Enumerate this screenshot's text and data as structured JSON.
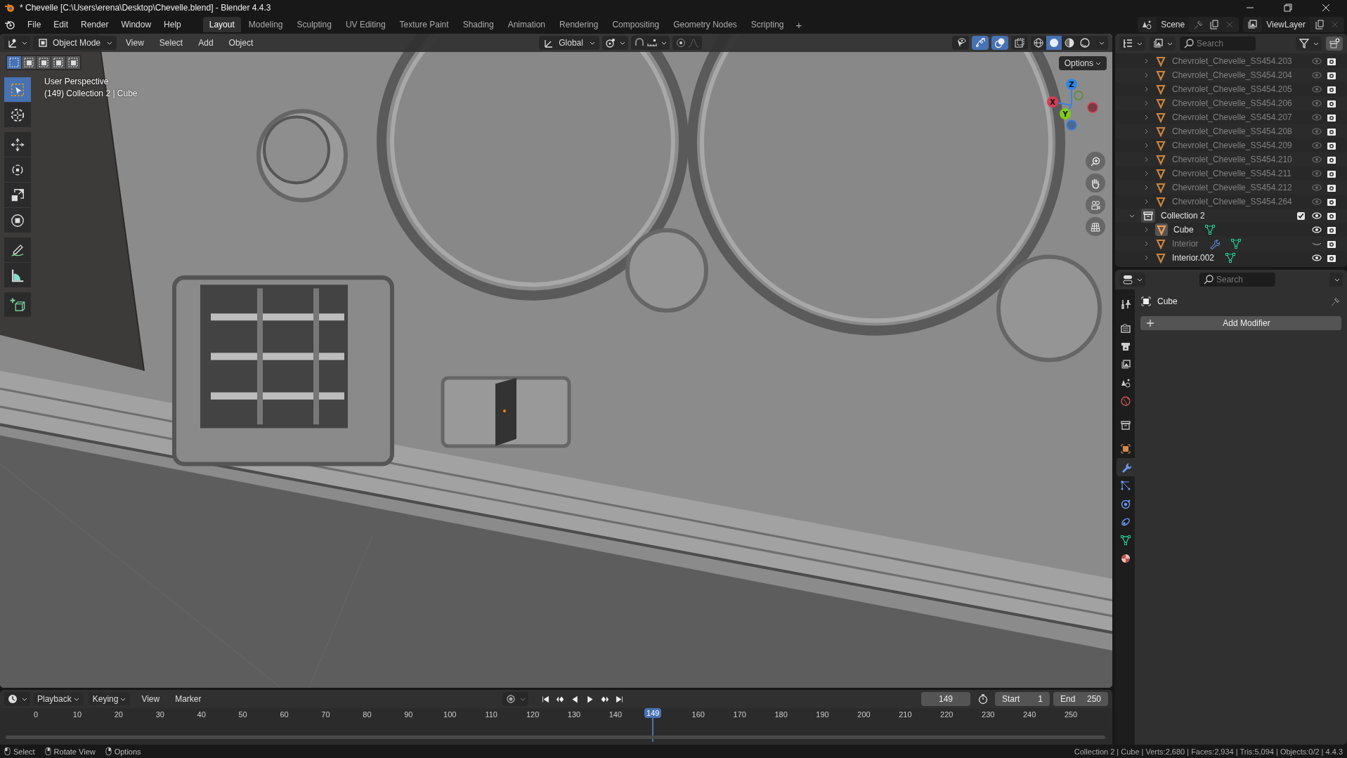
{
  "window": {
    "title": "* Chevelle [C:\\Users\\erena\\Desktop\\Chevelle.blend] - Blender 4.4.3"
  },
  "menu": [
    "File",
    "Edit",
    "Render",
    "Window",
    "Help"
  ],
  "workspace_tabs": [
    {
      "label": "Layout",
      "selected": true
    },
    {
      "label": "Modeling",
      "selected": false
    },
    {
      "label": "Sculpting",
      "selected": false
    },
    {
      "label": "UV Editing",
      "selected": false
    },
    {
      "label": "Texture Paint",
      "selected": false
    },
    {
      "label": "Shading",
      "selected": false
    },
    {
      "label": "Animation",
      "selected": false
    },
    {
      "label": "Rendering",
      "selected": false
    },
    {
      "label": "Compositing",
      "selected": false
    },
    {
      "label": "Geometry Nodes",
      "selected": false
    },
    {
      "label": "Scripting",
      "selected": false
    }
  ],
  "add_workspace": "+",
  "scene": "Scene",
  "view_layer": "ViewLayer",
  "viewport": {
    "mode": "Object Mode",
    "menus": [
      "View",
      "Select",
      "Add",
      "Object"
    ],
    "orientation": "Global",
    "select_modes": [
      {
        "selected": true
      },
      {
        "selected": false
      },
      {
        "selected": false
      },
      {
        "selected": false
      },
      {
        "selected": false
      }
    ],
    "toggles": [
      {
        "selected": false
      },
      {
        "selected": true
      },
      {
        "selected": true
      },
      {
        "selected": false
      }
    ],
    "shading": [
      {
        "selected": false
      },
      {
        "selected": true
      },
      {
        "selected": false
      },
      {
        "selected": false
      }
    ],
    "options": "Options",
    "overlay_text": [
      "User Perspective",
      "(149) Collection 2 | Cube"
    ],
    "tools": [
      {
        "selected": true
      },
      {
        "selected": false
      },
      {
        "selected": false
      },
      {
        "selected": false
      },
      {
        "selected": false
      },
      {
        "selected": false
      },
      {
        "selected": false
      },
      {
        "selected": false
      },
      {
        "selected": false
      }
    ],
    "axes": [
      "X",
      "Y",
      "Z"
    ]
  },
  "outliner": {
    "search_placeholder": "Search",
    "rows": [
      {
        "kind": "object",
        "name": "Chevrolet_Chevelle_SS454.203",
        "expanded": false,
        "dimmed": true,
        "visible": true,
        "active": false,
        "modifier": false,
        "mesh_data": false
      },
      {
        "kind": "object",
        "name": "Chevrolet_Chevelle_SS454.204",
        "expanded": false,
        "dimmed": true,
        "visible": true,
        "active": false,
        "modifier": false,
        "mesh_data": false
      },
      {
        "kind": "object",
        "name": "Chevrolet_Chevelle_SS454.205",
        "expanded": false,
        "dimmed": true,
        "visible": true,
        "active": false,
        "modifier": false,
        "mesh_data": false
      },
      {
        "kind": "object",
        "name": "Chevrolet_Chevelle_SS454.206",
        "expanded": false,
        "dimmed": true,
        "visible": true,
        "active": false,
        "modifier": false,
        "mesh_data": false
      },
      {
        "kind": "object",
        "name": "Chevrolet_Chevelle_SS454.207",
        "expanded": false,
        "dimmed": true,
        "visible": true,
        "active": false,
        "modifier": false,
        "mesh_data": false
      },
      {
        "kind": "object",
        "name": "Chevrolet_Chevelle_SS454.208",
        "expanded": false,
        "dimmed": true,
        "visible": true,
        "active": false,
        "modifier": false,
        "mesh_data": false
      },
      {
        "kind": "object",
        "name": "Chevrolet_Chevelle_SS454.209",
        "expanded": false,
        "dimmed": true,
        "visible": true,
        "active": false,
        "modifier": false,
        "mesh_data": false
      },
      {
        "kind": "object",
        "name": "Chevrolet_Chevelle_SS454.210",
        "expanded": false,
        "dimmed": true,
        "visible": true,
        "active": false,
        "modifier": false,
        "mesh_data": false
      },
      {
        "kind": "object",
        "name": "Chevrolet_Chevelle_SS454.211",
        "expanded": false,
        "dimmed": true,
        "visible": true,
        "active": false,
        "modifier": false,
        "mesh_data": false
      },
      {
        "kind": "object",
        "name": "Chevrolet_Chevelle_SS454.212",
        "expanded": false,
        "dimmed": true,
        "visible": true,
        "active": false,
        "modifier": false,
        "mesh_data": false
      },
      {
        "kind": "object",
        "name": "Chevrolet_Chevelle_SS454.264",
        "expanded": false,
        "dimmed": true,
        "visible": true,
        "active": false,
        "modifier": false,
        "mesh_data": false
      },
      {
        "kind": "collection",
        "name": "Collection 2",
        "expanded": true,
        "checked": true,
        "visible": true,
        "children": [
          {
            "kind": "object",
            "name": "Cube",
            "expanded": false,
            "dimmed": false,
            "visible": true,
            "active": true,
            "modifier": false,
            "mesh_data": true
          },
          {
            "kind": "object",
            "name": "Interior",
            "expanded": false,
            "dimmed": true,
            "visible": false,
            "active": false,
            "modifier": true,
            "mesh_data": true
          },
          {
            "kind": "object",
            "name": "Interior.002",
            "expanded": false,
            "dimmed": false,
            "visible": true,
            "active": false,
            "modifier": false,
            "mesh_data": true
          }
        ]
      }
    ]
  },
  "properties": {
    "search_placeholder": "Search",
    "tabs": [
      {
        "selected": false
      },
      {
        "selected": false
      },
      {
        "selected": false
      },
      {
        "selected": false
      },
      {
        "selected": false
      },
      {
        "selected": false
      },
      {
        "selected": false
      },
      {
        "selected": false
      },
      {
        "selected": true
      },
      {
        "selected": false
      },
      {
        "selected": false
      },
      {
        "selected": false
      },
      {
        "selected": false
      },
      {
        "selected": false
      }
    ],
    "object_name": "Cube",
    "add_modifier": "Add Modifier"
  },
  "timeline": {
    "menus": [
      "Playback",
      "Keying",
      "View",
      "Marker"
    ],
    "current_frame": "149",
    "start_label": "Start",
    "start": "1",
    "end_label": "End",
    "end": "250",
    "ticks": [
      "0",
      "10",
      "20",
      "30",
      "40",
      "50",
      "60",
      "70",
      "80",
      "90",
      "100",
      "110",
      "120",
      "130",
      "140",
      "160",
      "170",
      "180",
      "190",
      "200",
      "210",
      "220",
      "230",
      "240",
      "250"
    ],
    "playhead": {
      "label": "149",
      "level": 0.587
    }
  },
  "status_bar": {
    "hints": [
      "Select",
      "Rotate View",
      "Options"
    ],
    "stats": "Collection 2 | Cube | Verts:2,680 | Faces:2,934 | Tris:5,094 | Objects:0/2 | 4.4.3"
  }
}
